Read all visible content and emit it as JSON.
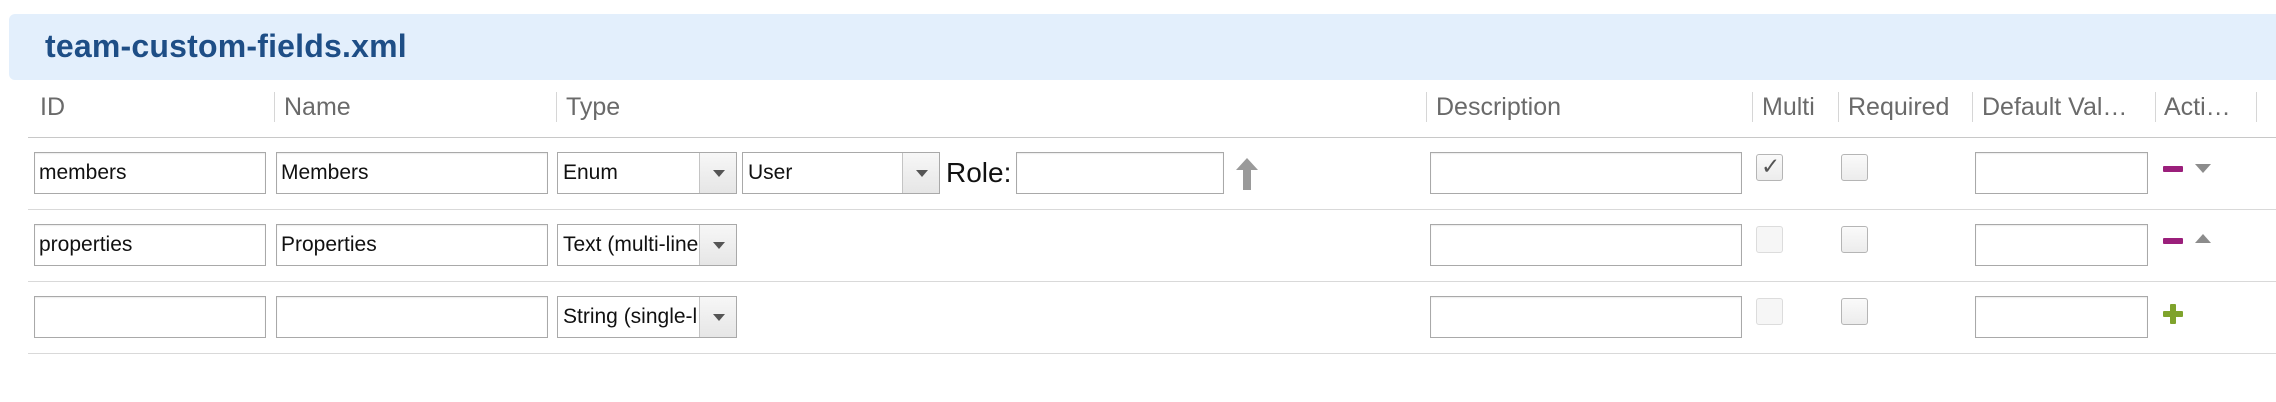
{
  "header": {
    "title": "team-custom-fields.xml"
  },
  "columns": [
    "ID",
    "Name",
    "Type",
    "Description",
    "Multi",
    "Required",
    "Default Val…",
    "Acti…"
  ],
  "rows": [
    {
      "id": "members",
      "name": "Members",
      "type": "Enum",
      "subtype": "User",
      "role_label": "Role:",
      "role": "",
      "description": "",
      "multi": true,
      "required": false,
      "default": ""
    },
    {
      "id": "properties",
      "name": "Properties",
      "type": "Text (multi-line)",
      "description": "",
      "multi": false,
      "required": false,
      "default": ""
    },
    {
      "id": "",
      "name": "",
      "type": "String (single-line)",
      "description": "",
      "multi": false,
      "required": false,
      "default": ""
    }
  ],
  "icons": {
    "move_up": "arrow-up-icon",
    "remove": "minus-icon",
    "move_down": "triangle-down-icon",
    "move_up_small": "triangle-up-icon",
    "add": "plus-icon"
  },
  "colors": {
    "header_bg": "#e3effc",
    "title": "#1e4e86",
    "remove": "#9b1f7b",
    "add": "#7fa32c"
  }
}
